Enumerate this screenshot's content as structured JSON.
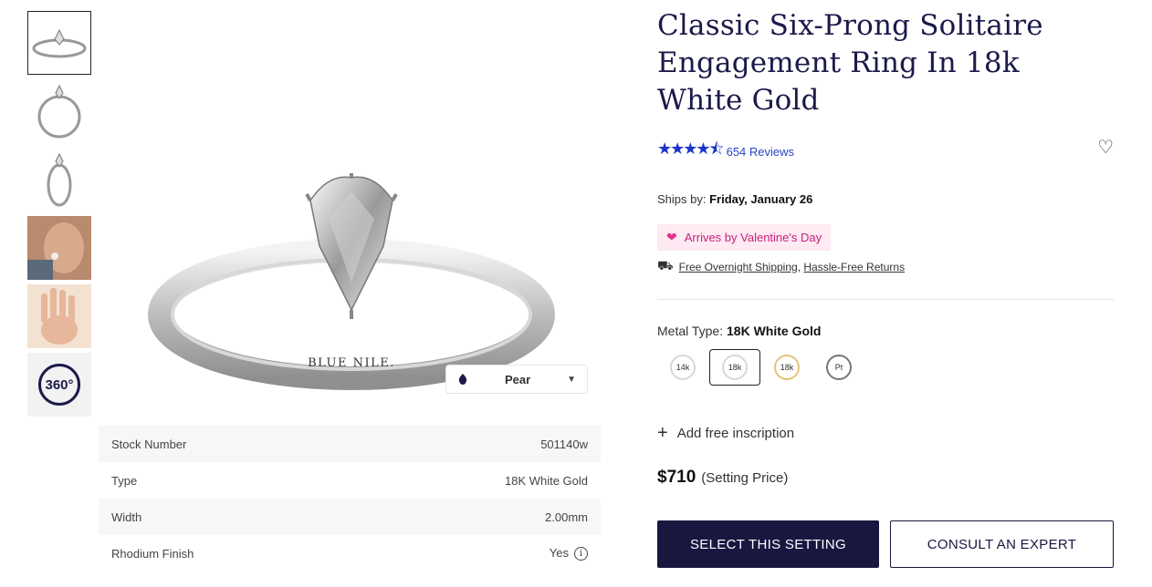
{
  "thumbnails": [
    {
      "name": "thumb-front-view"
    },
    {
      "name": "thumb-side-view"
    },
    {
      "name": "thumb-angle-view"
    },
    {
      "name": "thumb-hand-photo"
    },
    {
      "name": "thumb-hand-back"
    },
    {
      "name": "thumb-360",
      "label": "360°"
    }
  ],
  "main_image": {
    "engraving": "BLUE NILE."
  },
  "shape_select": {
    "value": "Pear"
  },
  "specs": [
    {
      "label": "Stock Number",
      "value": "501140w"
    },
    {
      "label": "Type",
      "value": "18K White Gold"
    },
    {
      "label": "Width",
      "value": "2.00mm"
    },
    {
      "label": "Rhodium Finish",
      "value": "Yes"
    }
  ],
  "product": {
    "title": "Classic Six-Prong Solitaire Engagement Ring In 18k White Gold",
    "stars": "★★★★⯪",
    "rating_value": 4.5,
    "reviews": "654 Reviews",
    "ships_label": "Ships by:",
    "ships_date": "Friday, January 26",
    "valentine": "Arrives by Valentine's Day",
    "free_shipping": "Free Overnight Shipping,",
    "returns": "Hassle-Free Returns",
    "metal_label": "Metal Type:",
    "metal_value": "18K White Gold",
    "metals": [
      {
        "label": "14k",
        "selected": false
      },
      {
        "label": "18k",
        "selected": true
      },
      {
        "label": "18k",
        "selected": false
      },
      {
        "label": "Pt",
        "selected": false
      }
    ],
    "inscription": "Add free inscription",
    "price": "$710",
    "price_note": "(Setting Price)",
    "select_button": "SELECT THIS SETTING",
    "consult_button": "CONSULT AN EXPERT"
  },
  "colors": {
    "navy": "#171740",
    "star_blue": "#1c36c9",
    "valentine_pink": "#c4237e"
  }
}
